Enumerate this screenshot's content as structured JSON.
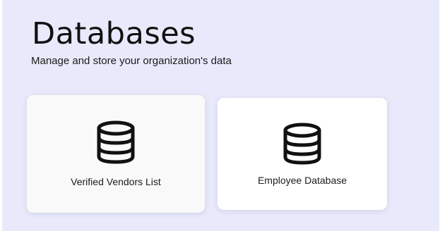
{
  "header": {
    "title": "Databases",
    "subtitle": "Manage and store your organization's data"
  },
  "databases": [
    {
      "label": "Verified Vendors List",
      "icon": "database-icon"
    },
    {
      "label": "Employee Database",
      "icon": "database-icon"
    }
  ],
  "colors": {
    "page_background": "#e8eafb",
    "card_background_hover": "#f9f9f9",
    "card_background": "#ffffff",
    "text": "#111111"
  }
}
